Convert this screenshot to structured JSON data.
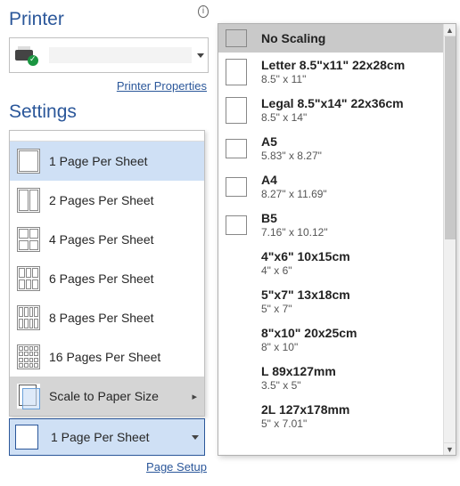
{
  "printer": {
    "title": "Printer",
    "properties_link": "Printer Properties"
  },
  "settings": {
    "title": "Settings",
    "pages": [
      {
        "label": "1 Page Per Sheet",
        "cells": 1
      },
      {
        "label": "2 Pages Per Sheet",
        "cells": 2
      },
      {
        "label": "4 Pages Per Sheet",
        "cells": 4
      },
      {
        "label": "6 Pages Per Sheet",
        "cells": 6
      },
      {
        "label": "8 Pages Per Sheet",
        "cells": 8
      },
      {
        "label": "16 Pages Per Sheet",
        "cells": 16
      }
    ],
    "scale_label": "Scale to Paper Size",
    "current": "1 Page Per Sheet",
    "page_setup_link": "Page Setup"
  },
  "paper": {
    "noscale": "No Scaling",
    "items": [
      {
        "name": "Letter 8.5\"x11\" 22x28cm",
        "sub": "8.5\" x 11\""
      },
      {
        "name": "Legal 8.5\"x14\" 22x36cm",
        "sub": "8.5\" x 14\""
      },
      {
        "name": "A5",
        "sub": "5.83\" x 8.27\""
      },
      {
        "name": "A4",
        "sub": "8.27\" x 11.69\""
      },
      {
        "name": "B5",
        "sub": "7.16\" x 10.12\""
      },
      {
        "name": "4\"x6\" 10x15cm",
        "sub": "4\" x 6\""
      },
      {
        "name": "5\"x7\" 13x18cm",
        "sub": "5\" x 7\""
      },
      {
        "name": "8\"x10\" 20x25cm",
        "sub": "8\" x 10\""
      },
      {
        "name": "L 89x127mm",
        "sub": "3.5\" x 5\""
      },
      {
        "name": "2L 127x178mm",
        "sub": "5\" x 7.01\""
      }
    ]
  }
}
